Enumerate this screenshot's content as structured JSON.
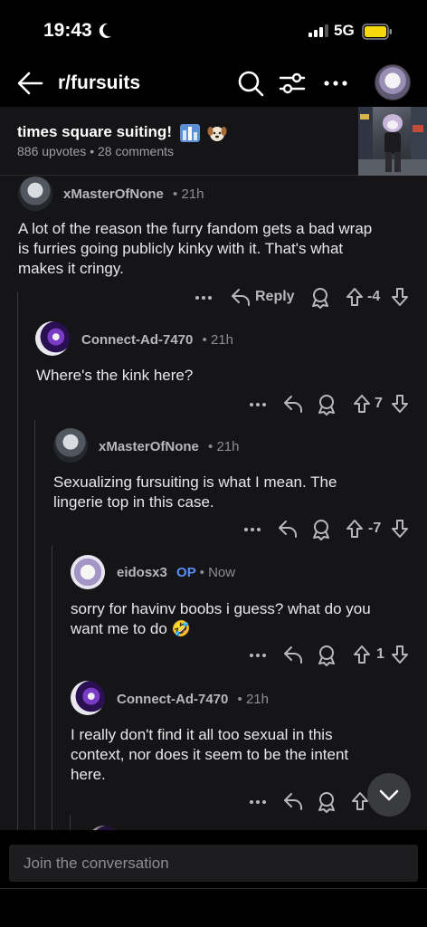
{
  "status": {
    "time": "19:43",
    "network": "5G"
  },
  "nav": {
    "title": "r/fursuits"
  },
  "post": {
    "title": "times square suiting!",
    "upvotes": "886 upvotes",
    "comments": "28 comments"
  },
  "comments": [
    {
      "author": "xMasterOfNone",
      "op": "",
      "age": "21h",
      "lines": [
        "A lot of the reason the furry fandom gets a bad wrap",
        "is furries going publicly kinky with it. That's what",
        "makes it cringy."
      ],
      "reply_label": "Reply",
      "score": "-4"
    },
    {
      "author": "Connect-Ad-7470",
      "op": "",
      "age": "21h",
      "lines": [
        "Where's the kink here?"
      ],
      "score": "7"
    },
    {
      "author": "xMasterOfNone",
      "op": "",
      "age": "21h",
      "lines": [
        "Sexualizing fursuiting is what I mean. The",
        "lingerie top in this case."
      ],
      "score": "-7"
    },
    {
      "author": "eidosx3",
      "op": "OP",
      "age": "Now",
      "lines": [
        "sorry for havinv boobs i guess? what do you",
        "want me to do 🤣"
      ],
      "score": "1"
    },
    {
      "author": "Connect-Ad-7470",
      "op": "",
      "age": "21h",
      "lines": [
        "I really don't find it all too sexual in this",
        "context, nor does it seem to be the intent",
        "here."
      ],
      "score": ""
    }
  ],
  "separator": "•",
  "footer": {
    "placeholder": "Join the conversation"
  },
  "colors": {
    "background": "#000000",
    "surface": "#151517",
    "op_badge": "#5b8cf4"
  },
  "icons": [
    "moon-icon",
    "signal-icon",
    "battery-icon",
    "back-arrow-icon",
    "search-icon",
    "filter-icon",
    "more-icon",
    "reply-icon",
    "award-icon",
    "upvote-icon",
    "downvote-icon",
    "chevron-down-icon"
  ]
}
